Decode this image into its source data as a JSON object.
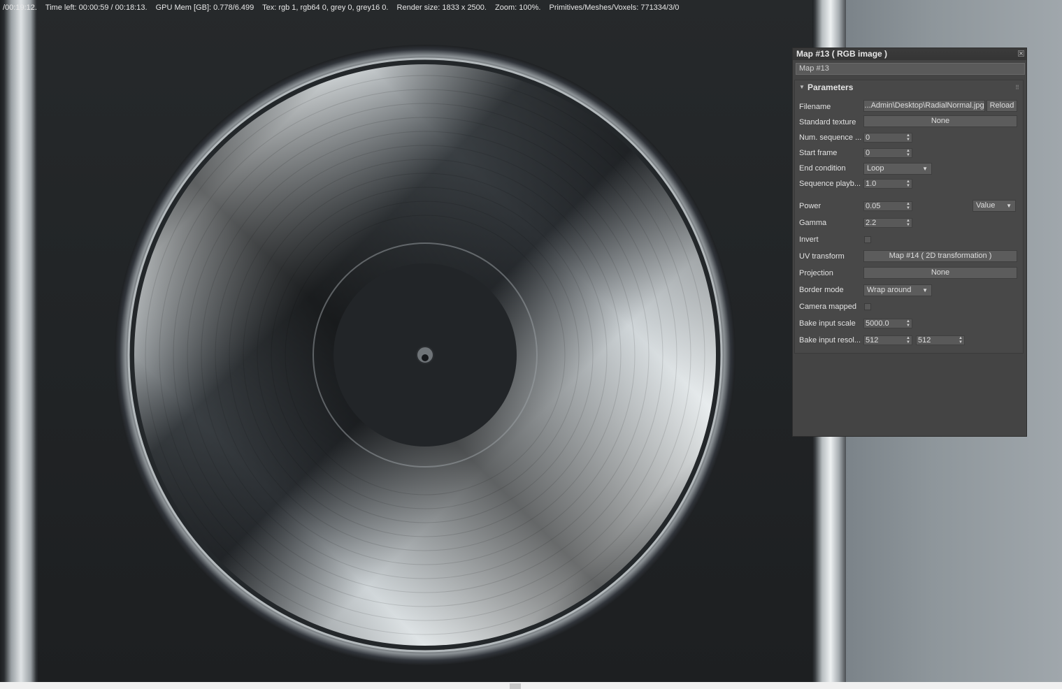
{
  "status_bar": {
    "elapsed": "/00:19:12.",
    "time_left": "Time left: 00:00:59 / 00:18:13.",
    "gpu_mem": "GPU Mem [GB]: 0.778/6.499",
    "tex": "Tex: rgb 1, rgb64 0, grey 0, grey16 0.",
    "render_size": "Render size: 1833 x 2500.",
    "zoom": "Zoom: 100%.",
    "primitives": "Primitives/Meshes/Voxels: 771334/3/0"
  },
  "panel": {
    "title": "Map #13  ( RGB image )",
    "close_glyph": "×",
    "map_name": "Map #13",
    "rollout_title": "Parameters",
    "rows": {
      "filename": {
        "label": "Filename",
        "value": "...Admin\\Desktop\\RadialNormal.jpg",
        "reload": "Reload"
      },
      "standard_texture": {
        "label": "Standard texture",
        "value": "None"
      },
      "num_sequence": {
        "label": "Num. sequence ...",
        "value": "0"
      },
      "start_frame": {
        "label": "Start frame",
        "value": "0"
      },
      "end_condition": {
        "label": "End condition",
        "value": "Loop"
      },
      "sequence_playback": {
        "label": "Sequence playb...",
        "value": "1.0"
      },
      "power": {
        "label": "Power",
        "value": "0.05",
        "mode": "Value"
      },
      "gamma": {
        "label": "Gamma",
        "value": "2.2"
      },
      "invert": {
        "label": "Invert",
        "checked": false
      },
      "uv_transform": {
        "label": "UV transform",
        "value": "Map #14  ( 2D transformation )"
      },
      "projection": {
        "label": "Projection",
        "value": "None"
      },
      "border_mode": {
        "label": "Border mode",
        "value": "Wrap around"
      },
      "camera_mapped": {
        "label": "Camera mapped",
        "checked": false
      },
      "bake_input_scale": {
        "label": "Bake input scale",
        "value": "5000.0"
      },
      "bake_input_resolution": {
        "label": "Bake input resol...",
        "value_x": "512",
        "value_y": "512"
      }
    }
  }
}
